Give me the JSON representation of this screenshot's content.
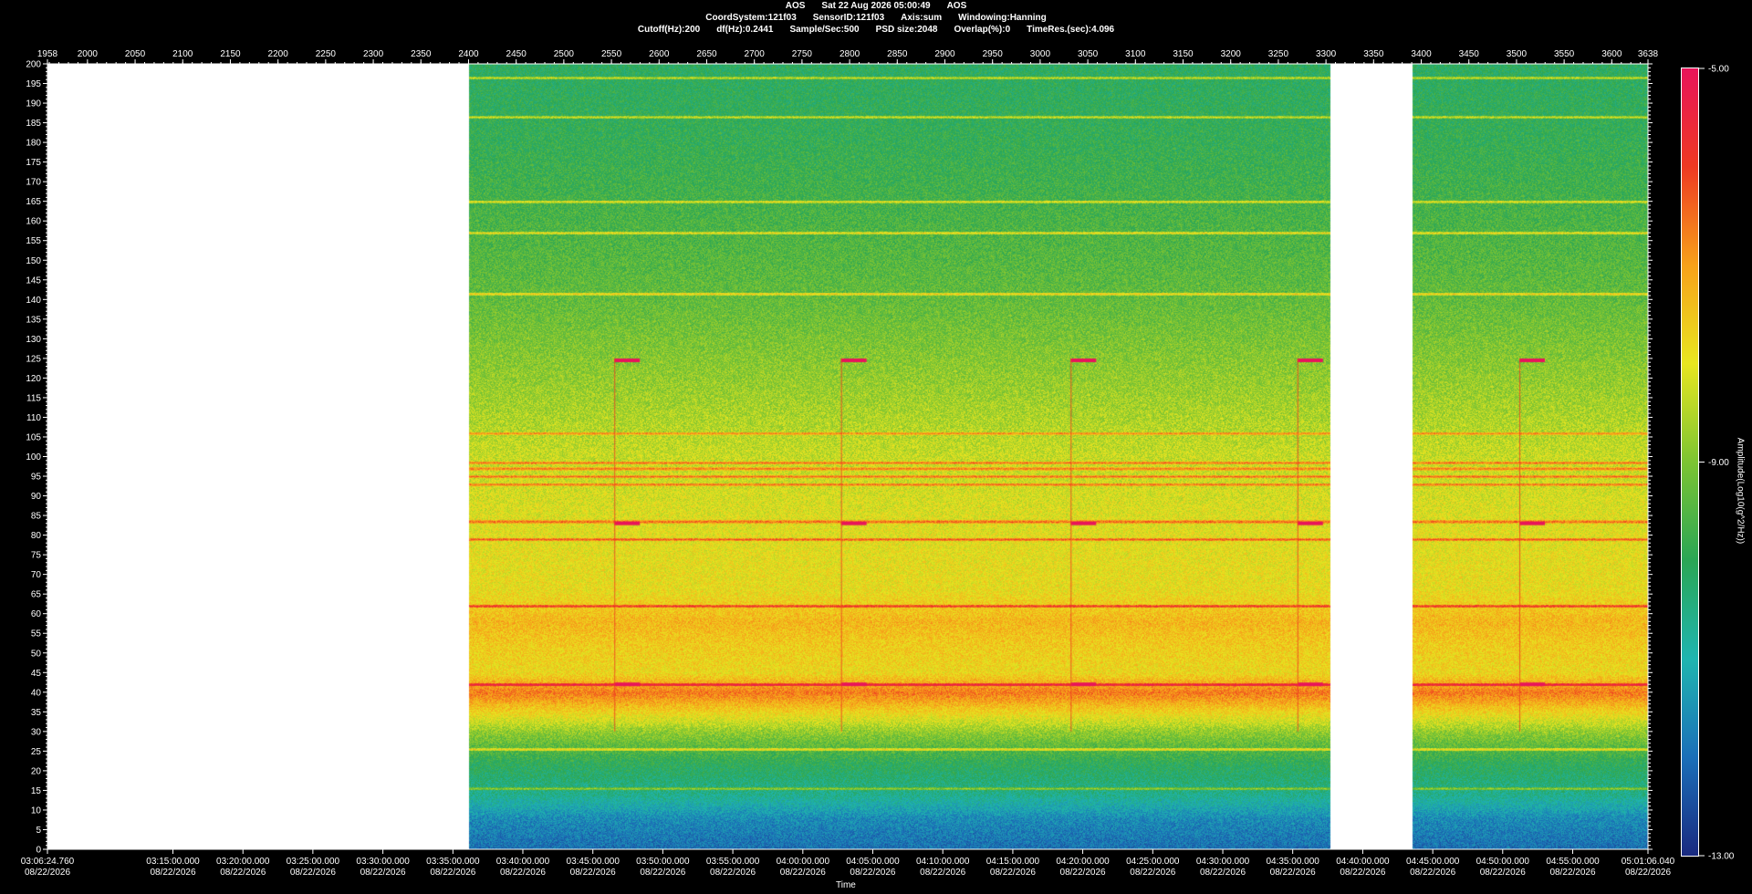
{
  "header": {
    "line1": [
      "AOS",
      "Sat 22 Aug 2026 05:00:49",
      "AOS"
    ],
    "line2": [
      "CoordSystem:121f03",
      "SensorID:121f03",
      "Axis:sum",
      "Windowing:Hanning"
    ],
    "line3": [
      "Cutoff(Hz):200",
      "df(Hz):0.2441",
      "Sample/Sec:500",
      "PSD size:2048",
      "Overlap(%):0",
      "TimeRes.(sec):4.096"
    ]
  },
  "chart_data": {
    "type": "heatmap",
    "title": "AOS  Sat 22 Aug 2026 05:00:49  AOS",
    "xlabel": "Time",
    "ylabel": "",
    "colorbar_label": "Amplitude(Log10(g^2/Hz))",
    "colorbar_ticks": [
      "-5.00",
      "-9.00",
      "-13.00"
    ],
    "zlim": [
      -13,
      -5
    ],
    "ylim": [
      0,
      200
    ],
    "y_ticks": [
      0,
      5,
      10,
      15,
      20,
      25,
      30,
      35,
      40,
      45,
      50,
      55,
      60,
      65,
      70,
      75,
      80,
      85,
      90,
      95,
      100,
      105,
      110,
      115,
      120,
      125,
      130,
      135,
      140,
      145,
      150,
      155,
      160,
      165,
      170,
      175,
      180,
      185,
      190,
      195,
      200
    ],
    "top_axis_range": [
      1958,
      3638
    ],
    "top_ticks": [
      "1958",
      "2000",
      "2050",
      "2100",
      "2150",
      "2200",
      "2250",
      "2300",
      "2350",
      "2400",
      "2450",
      "2500",
      "2550",
      "2600",
      "2650",
      "2700",
      "2750",
      "2800",
      "2850",
      "2900",
      "2950",
      "3000",
      "3050",
      "3100",
      "3150",
      "3200",
      "3250",
      "3300",
      "3350",
      "3400",
      "3450",
      "3500",
      "3550",
      "3600",
      "3638"
    ],
    "time_ticks": [
      {
        "time": "03:06:24.760",
        "date": "08/22/2026"
      },
      {
        "time": "03:15:00.000",
        "date": "08/22/2026"
      },
      {
        "time": "03:20:00.000",
        "date": "08/22/2026"
      },
      {
        "time": "03:25:00.000",
        "date": "08/22/2026"
      },
      {
        "time": "03:30:00.000",
        "date": "08/22/2026"
      },
      {
        "time": "03:35:00.000",
        "date": "08/22/2026"
      },
      {
        "time": "03:40:00.000",
        "date": "08/22/2026"
      },
      {
        "time": "03:45:00.000",
        "date": "08/22/2026"
      },
      {
        "time": "03:50:00.000",
        "date": "08/22/2026"
      },
      {
        "time": "03:55:00.000",
        "date": "08/22/2026"
      },
      {
        "time": "04:00:00.000",
        "date": "08/22/2026"
      },
      {
        "time": "04:05:00.000",
        "date": "08/22/2026"
      },
      {
        "time": "04:10:00.000",
        "date": "08/22/2026"
      },
      {
        "time": "04:15:00.000",
        "date": "08/22/2026"
      },
      {
        "time": "04:20:00.000",
        "date": "08/22/2026"
      },
      {
        "time": "04:25:00.000",
        "date": "08/22/2026"
      },
      {
        "time": "04:30:00.000",
        "date": "08/22/2026"
      },
      {
        "time": "04:35:00.000",
        "date": "08/22/2026"
      },
      {
        "time": "04:40:00.000",
        "date": "08/22/2026"
      },
      {
        "time": "04:45:00.000",
        "date": "08/22/2026"
      },
      {
        "time": "04:50:00.000",
        "date": "08/22/2026"
      },
      {
        "time": "04:55:00.000",
        "date": "08/22/2026"
      },
      {
        "time": "05:01:06.040",
        "date": "08/22/2026"
      }
    ],
    "data_segments": [
      [
        2400,
        3304
      ],
      [
        3390,
        3638
      ]
    ],
    "spectral_lines_hz": [
      196.5,
      186.5,
      165,
      157,
      141.5,
      106,
      98.5,
      97,
      95,
      93,
      83.5,
      79,
      62,
      42,
      25.5,
      15.5
    ],
    "periodic_events_index": [
      2553,
      2791,
      3032,
      3270,
      3503
    ],
    "event_lines_hz": [
      124.5,
      83,
      42
    ],
    "band_levels": [
      {
        "hz": 0,
        "level": -12.0
      },
      {
        "hz": 8,
        "level": -11.6
      },
      {
        "hz": 14,
        "level": -10.6
      },
      {
        "hz": 22,
        "level": -10.0
      },
      {
        "hz": 30,
        "level": -8.8
      },
      {
        "hz": 36,
        "level": -7.5
      },
      {
        "hz": 40,
        "level": -6.6
      },
      {
        "hz": 45,
        "level": -7.8
      },
      {
        "hz": 52,
        "level": -7.6
      },
      {
        "hz": 58,
        "level": -7.3
      },
      {
        "hz": 66,
        "level": -7.9
      },
      {
        "hz": 80,
        "level": -8.0
      },
      {
        "hz": 100,
        "level": -8.3
      },
      {
        "hz": 120,
        "level": -8.8
      },
      {
        "hz": 140,
        "level": -9.3
      },
      {
        "hz": 160,
        "level": -9.6
      },
      {
        "hz": 180,
        "level": -9.9
      },
      {
        "hz": 200,
        "level": -10.1
      }
    ],
    "colors": {
      "background": "#000000",
      "gap": "#ffffff",
      "axis": "#ffffff",
      "colormap": [
        "#1a2a80",
        "#1b6fb8",
        "#1fb5b0",
        "#2aa655",
        "#7cc432",
        "#e8e620",
        "#f7a11a",
        "#ee3a22",
        "#e8145a"
      ]
    }
  }
}
